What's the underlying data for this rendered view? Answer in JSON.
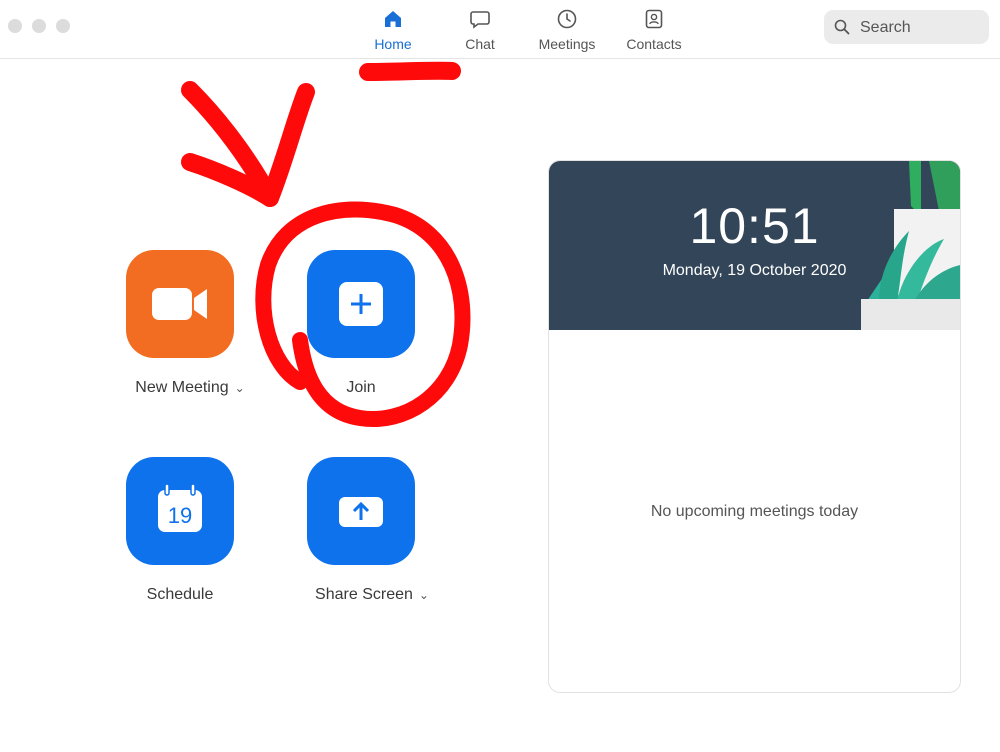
{
  "nav": {
    "tabs": [
      {
        "label": "Home",
        "icon": "home-icon",
        "active": true
      },
      {
        "label": "Chat",
        "icon": "chat-icon",
        "active": false
      },
      {
        "label": "Meetings",
        "icon": "clock-icon",
        "active": false
      },
      {
        "label": "Contacts",
        "icon": "contacts-icon",
        "active": false
      }
    ],
    "search_placeholder": "Search"
  },
  "actions": {
    "new_meeting": {
      "label": "New Meeting",
      "icon": "video-camera-icon",
      "color": "#f26d21"
    },
    "join": {
      "label": "Join",
      "icon": "plus-icon",
      "color": "#0e72ed"
    },
    "schedule": {
      "label": "Schedule",
      "icon": "calendar-icon",
      "day": "19",
      "color": "#0e72ed"
    },
    "share_screen": {
      "label": "Share Screen",
      "icon": "share-screen-icon",
      "color": "#0e72ed"
    }
  },
  "calendar": {
    "time": "10:51",
    "date": "Monday, 19 October 2020",
    "empty_message": "No upcoming meetings today"
  },
  "colors": {
    "accent": "#1a6fd6",
    "annotation": "#ff0000",
    "header_bg": "#334559"
  }
}
